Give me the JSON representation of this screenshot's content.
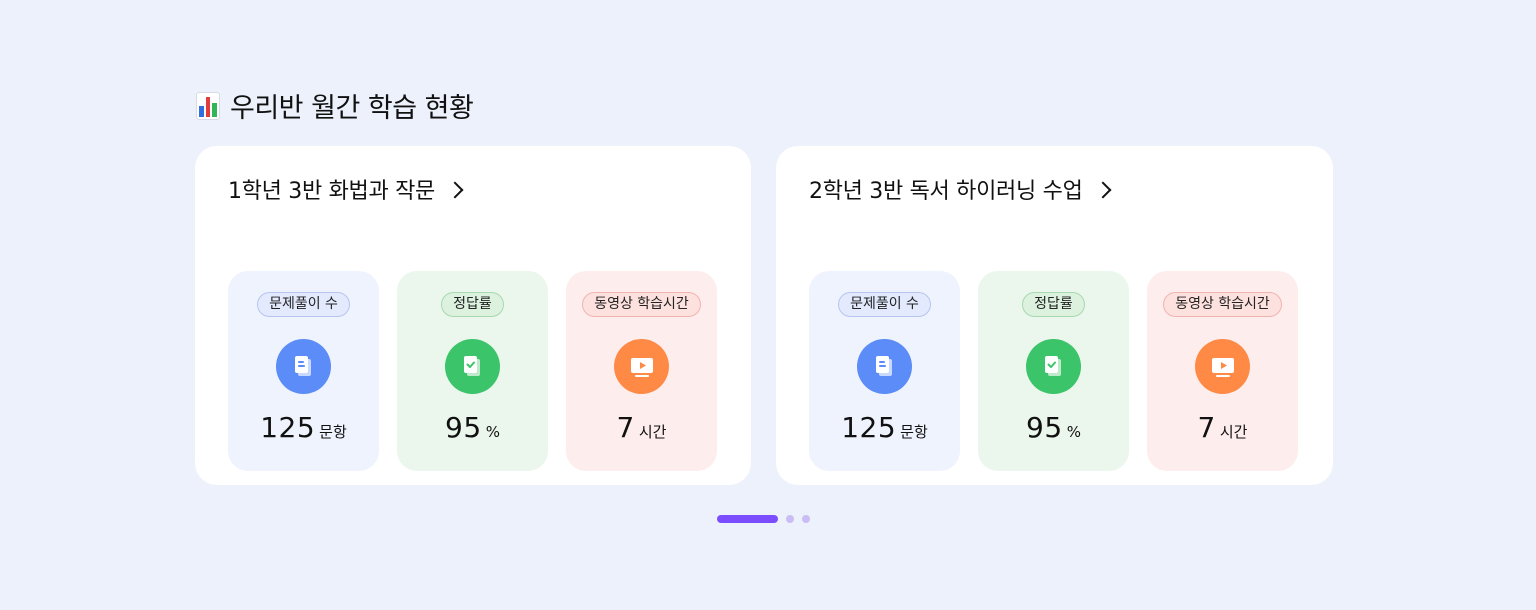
{
  "section": {
    "title": "우리반 월간 학습 현황",
    "icon": "bar-chart-icon"
  },
  "classes": [
    {
      "title": "1학년 3반 화법과 작문",
      "stats": [
        {
          "label": "문제풀이 수",
          "value": "125",
          "unit": "문항",
          "icon": "document-icon",
          "color": "#5b8cf7"
        },
        {
          "label": "정답률",
          "value": "95",
          "unit": "%",
          "icon": "check-document-icon",
          "color": "#3cc46a"
        },
        {
          "label": "동영상 학습시간",
          "value": "7",
          "unit": "시간",
          "icon": "video-play-icon",
          "color": "#ff8a46"
        }
      ]
    },
    {
      "title": "2학년 3반 독서 하이러닝 수업",
      "stats": [
        {
          "label": "문제풀이 수",
          "value": "125",
          "unit": "문항",
          "icon": "document-icon",
          "color": "#5b8cf7"
        },
        {
          "label": "정답률",
          "value": "95",
          "unit": "%",
          "icon": "check-document-icon",
          "color": "#3cc46a"
        },
        {
          "label": "동영상 학습시간",
          "value": "7",
          "unit": "시간",
          "icon": "video-play-icon",
          "color": "#ff8a46"
        }
      ]
    }
  ],
  "pager": {
    "current_page": 1,
    "total_pages": 3,
    "active_color": "#7c4dff"
  }
}
